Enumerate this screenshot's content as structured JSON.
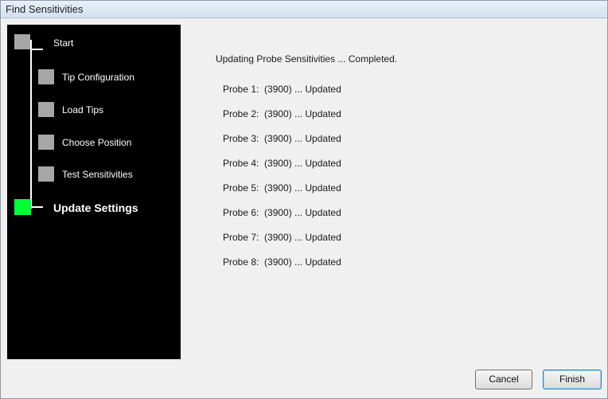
{
  "window": {
    "title": "Find Sensitivities"
  },
  "steps": [
    {
      "label": "Start",
      "state": "done"
    },
    {
      "label": "Tip Configuration",
      "state": "done"
    },
    {
      "label": "Load Tips",
      "state": "done"
    },
    {
      "label": "Choose Position",
      "state": "done"
    },
    {
      "label": "Test Sensitivities",
      "state": "done"
    },
    {
      "label": "Update Settings",
      "state": "current"
    }
  ],
  "colors": {
    "step_done": "#a6a6a6",
    "step_current": "#00ff33",
    "sidebar_bg": "#000000"
  },
  "main": {
    "status": "Updating Probe Sensitivities ... Completed.",
    "probes": [
      "Probe 1:  (3900) ... Updated",
      "Probe 2:  (3900) ... Updated",
      "Probe 3:  (3900) ... Updated",
      "Probe 4:  (3900) ... Updated",
      "Probe 5:  (3900) ... Updated",
      "Probe 6:  (3900) ... Updated",
      "Probe 7:  (3900) ... Updated",
      "Probe 8:  (3900) ... Updated"
    ]
  },
  "buttons": {
    "cancel": "Cancel",
    "finish": "Finish"
  }
}
